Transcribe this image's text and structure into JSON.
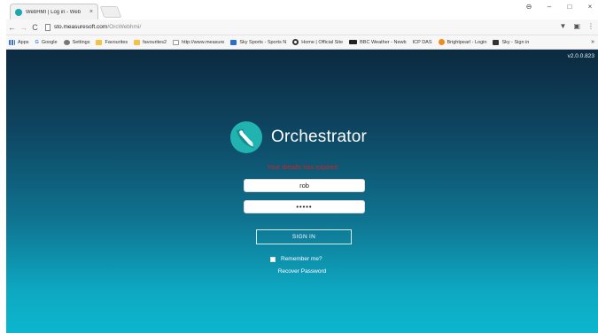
{
  "browser": {
    "tab_title": "WebHMI | Log in - Web",
    "tab_close": "×",
    "window_controls": {
      "minimize": "–",
      "maximize": "□",
      "close": "×",
      "profile": "⊖"
    },
    "nav": {
      "back": "←",
      "forward": "→",
      "reload": "C"
    },
    "url_host": "sto.measuresoft.com",
    "url_path": "/OrcWebhmi/",
    "toolbar_icons": {
      "filter": "▼",
      "extension": "▣",
      "menu": "⋮"
    },
    "bookmarks": [
      {
        "label": "Apps",
        "icon": "apps-grid-icon",
        "kind": "grid"
      },
      {
        "label": "Google",
        "icon": "google-icon",
        "kind": "text",
        "glyph": "G"
      },
      {
        "label": "Settings",
        "icon": "gear-icon",
        "kind": "gear"
      },
      {
        "label": "Favourites",
        "icon": "folder-icon",
        "kind": "folder"
      },
      {
        "label": "favourites2",
        "icon": "folder-icon",
        "kind": "folder"
      },
      {
        "label": "http://www.measure",
        "icon": "site-icon",
        "kind": "site"
      },
      {
        "label": "Sky Sports - Sports N",
        "icon": "sky-sports-icon",
        "kind": "sky"
      },
      {
        "label": "Home | Official Site",
        "icon": "ring-icon",
        "kind": "ring"
      },
      {
        "label": "BBC Weather - Newb",
        "icon": "bbc-icon",
        "kind": "bbc"
      },
      {
        "label": "ICP DAS",
        "icon": "",
        "kind": "none"
      },
      {
        "label": "Brightpearl - Login",
        "icon": "brightpearl-icon",
        "kind": "orange"
      },
      {
        "label": "Sky - Sign in",
        "icon": "sky-icon",
        "kind": "dark"
      }
    ],
    "bookmarks_more": "»"
  },
  "page": {
    "version": "v2.0.0.823",
    "brand_name": "Orchestrator",
    "error_message": "Your details has expired",
    "username_value": "rob",
    "password_value": "•••••",
    "signin_label": "SIGN IN",
    "remember_label": "Remember me?",
    "remember_checked": false,
    "recover_label": "Recover Password"
  },
  "colors": {
    "background_top": "#0c2a40",
    "background_bottom": "#0cb6ce",
    "error": "#d81e1e",
    "logo_teal": "#21b3b0"
  }
}
